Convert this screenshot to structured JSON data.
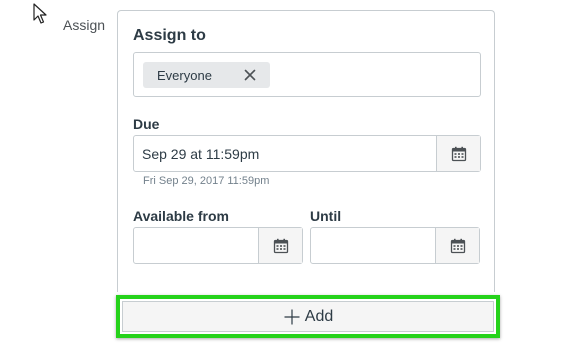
{
  "row_label": "Assign",
  "assign_to": {
    "title": "Assign to",
    "tokens": [
      {
        "label": "Everyone",
        "remove_icon": "close-icon"
      }
    ]
  },
  "due": {
    "label": "Due",
    "value": "Sep 29 at 11:59pm",
    "hint": "Fri Sep 29, 2017 11:59pm",
    "icon": "calendar-icon"
  },
  "available_from": {
    "label": "Available from",
    "value": "",
    "icon": "calendar-icon"
  },
  "until": {
    "label": "Until",
    "value": "",
    "icon": "calendar-icon"
  },
  "add_button": {
    "label": "Add",
    "icon": "plus-icon",
    "highlight_color": "#25d21a"
  }
}
